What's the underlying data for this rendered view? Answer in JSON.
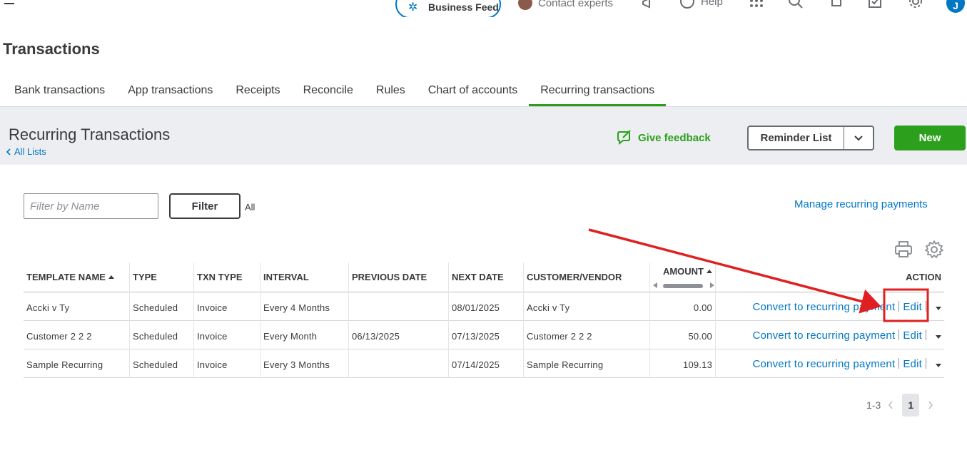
{
  "topbar": {
    "business_feed_label": "Business Feed",
    "contact_label": "Contact experts",
    "help_label": "Help",
    "user_initial": "J"
  },
  "page": {
    "title": "Transactions"
  },
  "tabs": [
    {
      "label": "Bank transactions"
    },
    {
      "label": "App transactions"
    },
    {
      "label": "Receipts"
    },
    {
      "label": "Reconcile"
    },
    {
      "label": "Rules"
    },
    {
      "label": "Chart of accounts"
    },
    {
      "label": "Recurring transactions",
      "active": true
    }
  ],
  "section": {
    "title": "Recurring Transactions",
    "back_link": "All Lists",
    "feedback_label": "Give feedback",
    "reminder_list_label": "Reminder List",
    "new_label": "New"
  },
  "filter": {
    "placeholder": "Filter by Name",
    "button_label": "Filter",
    "scope_label": "All",
    "manage_link": "Manage recurring payments"
  },
  "table": {
    "headers": {
      "template_name": "TEMPLATE NAME",
      "type": "TYPE",
      "txn_type": "TXN TYPE",
      "interval": "INTERVAL",
      "previous_date": "PREVIOUS DATE",
      "next_date": "NEXT DATE",
      "customer_vendor": "CUSTOMER/VENDOR",
      "amount": "AMOUNT",
      "action": "ACTION"
    },
    "rows": [
      {
        "template_name": "Accki v Ty",
        "type": "Scheduled",
        "txn_type": "Invoice",
        "interval": "Every 4 Months",
        "previous_date": "",
        "next_date": "08/01/2025",
        "customer_vendor": "Accki v Ty",
        "amount": "0.00",
        "convert_label": "Convert to recurring payment",
        "edit_label": "Edit"
      },
      {
        "template_name": "Customer 2 2 2",
        "type": "Scheduled",
        "txn_type": "Invoice",
        "interval": "Every Month",
        "previous_date": "06/13/2025",
        "next_date": "07/13/2025",
        "customer_vendor": "Customer 2 2 2",
        "amount": "50.00",
        "convert_label": "Convert to recurring payment",
        "edit_label": "Edit"
      },
      {
        "template_name": "Sample Recurring",
        "type": "Scheduled",
        "txn_type": "Invoice",
        "interval": "Every 3 Months",
        "previous_date": "",
        "next_date": "07/14/2025",
        "customer_vendor": "Sample Recurring",
        "amount": "109.13",
        "convert_label": "Convert to recurring payment",
        "edit_label": "Edit"
      }
    ]
  },
  "pagination": {
    "range": "1-3",
    "current_page": "1"
  },
  "colors": {
    "brand_green": "#2ca01c",
    "link_blue": "#0077c5",
    "annotation_red": "#e02020"
  }
}
